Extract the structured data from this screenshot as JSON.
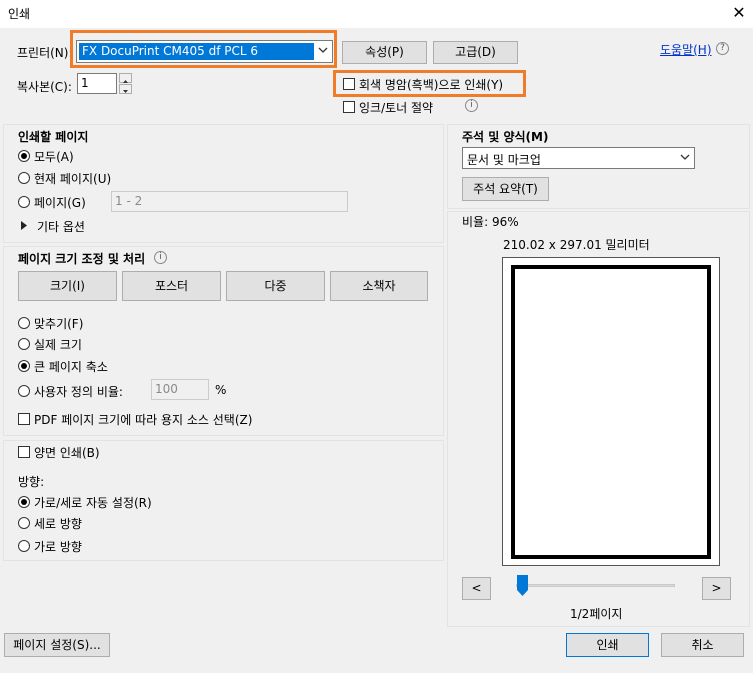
{
  "window": {
    "title": "인쇄",
    "close_glyph": "✕"
  },
  "printer": {
    "label": "프린터(N):",
    "selected": "FX DocuPrint CM405 df PCL 6",
    "properties_button": "속성(P)",
    "advanced_button": "고급(D)",
    "help_link": "도움말(H)",
    "help_icon": "help-icon"
  },
  "copies": {
    "label": "복사본(C):",
    "value": "1"
  },
  "options": {
    "grayscale_label": "회색 명암(흑백)으로 인쇄(Y)",
    "grayscale_checked": false,
    "save_ink_label": "잉크/토너 절약",
    "save_ink_checked": false
  },
  "pages_to_print": {
    "heading": "인쇄할 페이지",
    "all": "모두(A)",
    "current": "현재 페이지(U)",
    "pages": "페이지(G)",
    "pages_value": "1 - 2",
    "more_options": "기타 옵션",
    "selected": "all"
  },
  "page_sizing": {
    "heading": "페이지 크기 조정 및 처리",
    "buttons": [
      "크기(I)",
      "포스터",
      "다중",
      "소책자"
    ],
    "fit": "맞추기(F)",
    "actual": "실제 크기",
    "shrink": "큰 페이지 축소",
    "custom": "사용자 정의 비율:",
    "custom_value": "100",
    "percent": "%",
    "pdf_source_label": "PDF 페이지 크기에 따라 용지 소스 선택(Z)",
    "selected": "shrink"
  },
  "duplex": {
    "label": "양면 인쇄(B)"
  },
  "orientation": {
    "heading": "방향:",
    "auto": "가로/세로 자동 설정(R)",
    "portrait": "세로 방향",
    "landscape": "가로 방향",
    "selected": "auto"
  },
  "comments": {
    "heading": "주석 및 양식(M)",
    "selected": "문서 및 마크업",
    "summarize_button": "주석 요약(T)"
  },
  "preview": {
    "zoom_label": "비율:  96%",
    "dimensions": "210.02 x 297.01 밀리미터",
    "prev_button": "<",
    "next_button": ">",
    "page_indicator": "1/2페이지",
    "slider_position": 0
  },
  "footer": {
    "page_setup_button": "페이지 설정(S)...",
    "print_button": "인쇄",
    "cancel_button": "취소"
  },
  "colors": {
    "accent": "#0078d7",
    "highlight": "#f07c2a"
  }
}
